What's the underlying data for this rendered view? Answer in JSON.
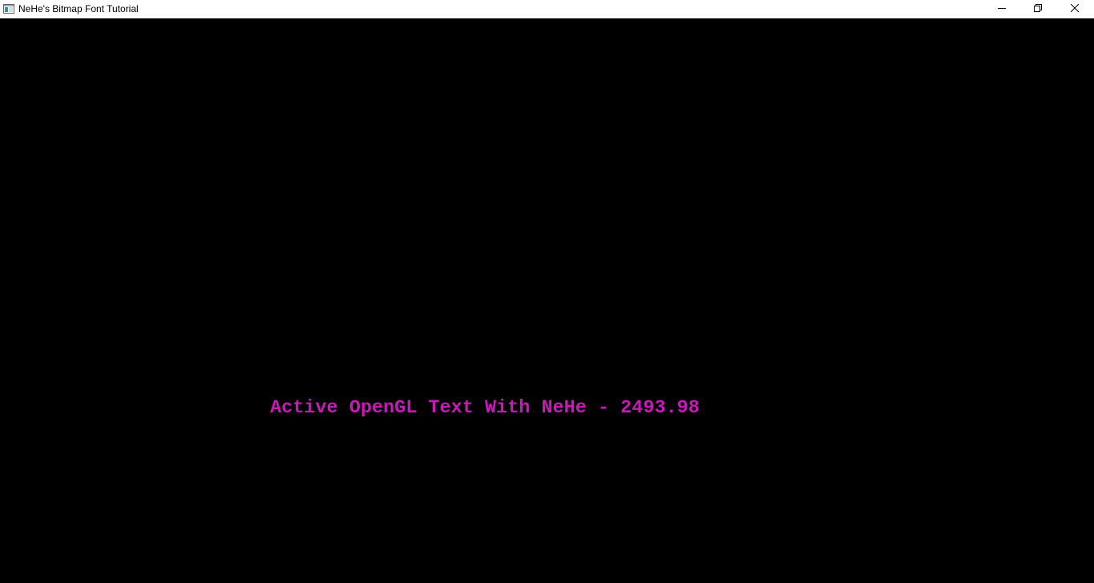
{
  "window": {
    "title": "NeHe's Bitmap Font Tutorial",
    "icon": "app-window-icon",
    "controls": {
      "minimize_icon": "minimize-icon",
      "maximize_icon": "restore-icon",
      "close_icon": "close-icon"
    }
  },
  "scene": {
    "background_color": "#000000",
    "text": "Active OpenGL Text With NeHe - 2493.98",
    "text_color": "#c71ab8"
  }
}
